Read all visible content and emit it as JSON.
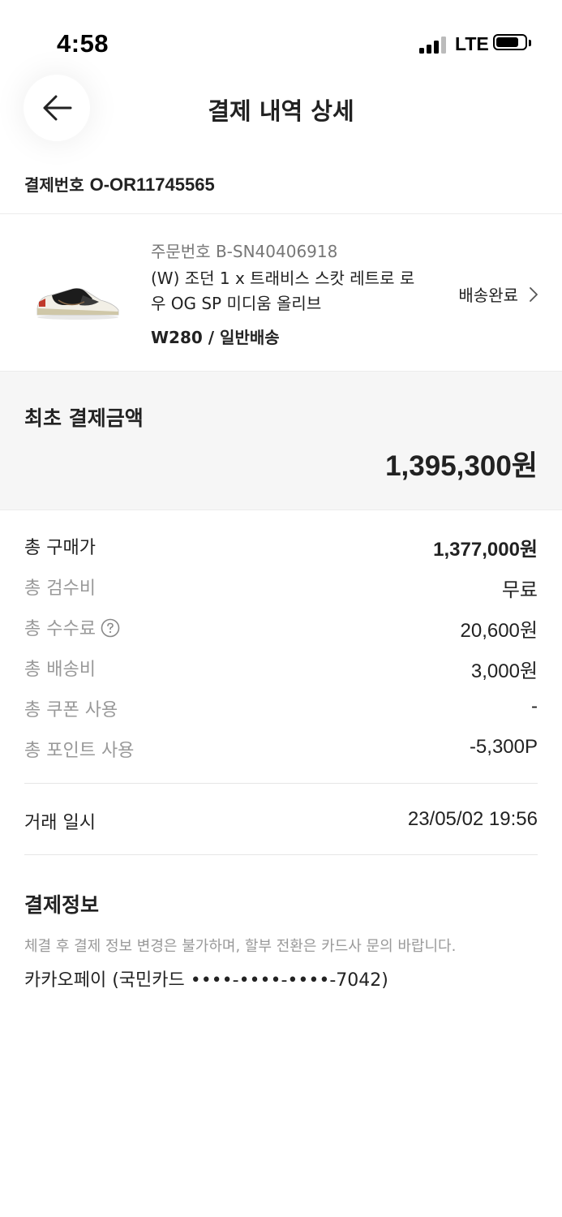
{
  "status_bar": {
    "time": "4:58",
    "network": "LTE"
  },
  "header": {
    "title": "결제 내역 상세"
  },
  "payment": {
    "label": "결제번호",
    "number": "O-OR11745565"
  },
  "order": {
    "order_number": "주문번호 B-SN40406918",
    "product_name": "(W) 조던 1 x 트래비스 스캇 레트로 로우 OG SP 미디움 올리브",
    "option": "W280 / 일반배송",
    "status": "배송완료"
  },
  "initial_payment": {
    "label": "최초 결제금액",
    "amount": "1,395,300원"
  },
  "breakdown": [
    {
      "label": "총 구매가",
      "value": "1,377,000원"
    },
    {
      "label": "총 검수비",
      "value": "무료"
    },
    {
      "label": "총 수수료",
      "value": "20,600원"
    },
    {
      "label": "총 배송비",
      "value": "3,000원"
    },
    {
      "label": "총 쿠폰 사용",
      "value": "-"
    },
    {
      "label": "총 포인트 사용",
      "value": "-5,300P"
    }
  ],
  "trade": {
    "label": "거래 일시",
    "value": "23/05/02 19:56"
  },
  "payment_info": {
    "title": "결제정보",
    "notice": "체결 후 결제 정보 변경은 불가하며, 할부 전환은 카드사 문의 바랍니다.",
    "method": "카카오페이 (국민카드 ••••-••••-••••-7042)"
  },
  "icons": {
    "back": "arrow-left-icon",
    "chevron": "chevron-right-icon",
    "help": "question-circle-icon"
  }
}
